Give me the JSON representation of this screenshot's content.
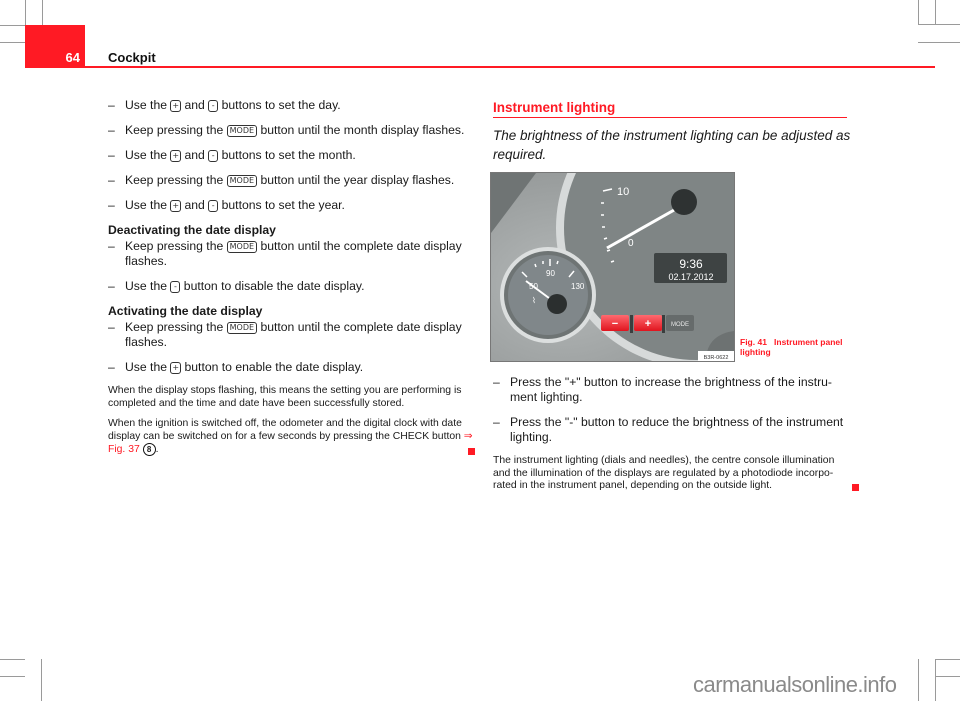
{
  "header": {
    "page_number": "64",
    "chapter": "Cockpit",
    "accent_color": "#ff1a24"
  },
  "left": {
    "steps_top": [
      {
        "pre": "Use the",
        "key1": "+",
        "mid": "and",
        "key2": "-",
        "post": "buttons to set the day."
      },
      {
        "pre": "Keep pressing the",
        "key1": "MODE",
        "post": "button until the month display flashes."
      },
      {
        "pre": "Use the",
        "key1": "+",
        "mid": "and",
        "key2": "-",
        "post": "buttons to set the month."
      },
      {
        "pre": "Keep pressing the",
        "key1": "MODE",
        "post": "button until the year display flashes."
      },
      {
        "pre": "Use the",
        "key1": "+",
        "mid": "and",
        "key2": "-",
        "post": "buttons to set the year."
      }
    ],
    "deactivate": {
      "heading": "Deactivating the date display",
      "steps": [
        {
          "pre": "Keep pressing the",
          "key1": "MODE",
          "post": "button until the complete date display flashes."
        },
        {
          "pre": "Use the",
          "key1": "-",
          "post": "button to disable the date display."
        }
      ]
    },
    "activate": {
      "heading": "Activating the date display",
      "steps": [
        {
          "pre": "Keep pressing the",
          "key1": "MODE",
          "post": "button until the complete date display flashes."
        },
        {
          "pre": "Use the",
          "key1": "+",
          "post": "button to enable the date display."
        }
      ]
    },
    "note1": "When the display stops flashing, this means the setting you are performing is completed and the time and date have been successfully stored.",
    "note2_pre": "When the ignition is switched off, the odometer and the digital clock with date display can be switched on for a few seconds by pressing the CHECK button",
    "note2_xref": "⇒ Fig. 37",
    "note2_callout": "8",
    "note2_post": "."
  },
  "right": {
    "section_title": "Instrument lighting",
    "lead": "The brightness of the instrument lighting can be adjusted as required.",
    "figure": {
      "clock_time": "9:36",
      "clock_date": "02.17.2012",
      "gauge_labels": [
        "50",
        "90",
        "130"
      ],
      "tach_label": "10",
      "tach_zero": "0",
      "buttons": [
        "−",
        "+",
        "MODE"
      ],
      "image_code": "B3R-0622",
      "caption_fig": "Fig. 41",
      "caption_text": "Instrument panel lighting"
    },
    "steps": [
      "Press the \"+\" button to increase the brightness of the instru-ment lighting.",
      "Press the \"-\" button to reduce the brightness of the instrument lighting."
    ],
    "note": "The instrument lighting (dials and needles), the centre console illumination and the illumination of the displays are regulated by a photodiode incorpo-rated in the instrument panel, depending on the outside light."
  },
  "watermark": "carmanualsonline.info",
  "step_dash": "–"
}
